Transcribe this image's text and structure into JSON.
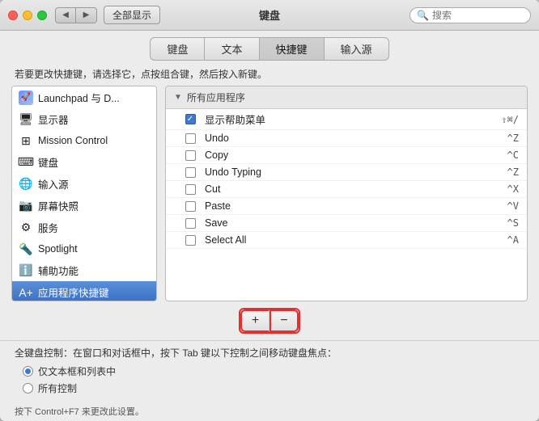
{
  "window": {
    "title": "键盘",
    "search_placeholder": "搜索"
  },
  "titlebar": {
    "show_all": "全部显示"
  },
  "tabs": [
    {
      "id": "keyboard",
      "label": "键盘"
    },
    {
      "id": "text",
      "label": "文本"
    },
    {
      "id": "shortcuts",
      "label": "快捷键",
      "active": true
    },
    {
      "id": "input",
      "label": "输入源"
    }
  ],
  "instruction": "若要更改快捷键，请选择它，点按组合键，然后按入新键。",
  "left_panel": {
    "items": [
      {
        "id": "launchpad",
        "label": "Launchpad 与 D...",
        "icon": "🚀"
      },
      {
        "id": "display",
        "label": "显示器",
        "icon": "🖥"
      },
      {
        "id": "mission",
        "label": "Mission Control",
        "icon": "⊞"
      },
      {
        "id": "keyboard",
        "label": "键盘",
        "icon": "⌨"
      },
      {
        "id": "inputsource",
        "label": "输入源",
        "icon": "🌐"
      },
      {
        "id": "screenshot",
        "label": "屏幕快照",
        "icon": "📷"
      },
      {
        "id": "service",
        "label": "服务",
        "icon": "⚙"
      },
      {
        "id": "spotlight",
        "label": "Spotlight",
        "icon": "🔍"
      },
      {
        "id": "accessibility",
        "label": "辅助功能",
        "icon": "ℹ"
      },
      {
        "id": "appshortcuts",
        "label": "应用程序快捷键",
        "icon": "A+",
        "selected": true
      }
    ]
  },
  "right_panel": {
    "header": "所有应用程序",
    "rows": [
      {
        "id": "show-help",
        "label": "显示帮助菜单",
        "checked": true,
        "shortcut": "⇧⌘/"
      },
      {
        "id": "undo",
        "label": "Undo",
        "checked": false,
        "shortcut": "^Z"
      },
      {
        "id": "copy",
        "label": "Copy",
        "checked": false,
        "shortcut": "^C"
      },
      {
        "id": "undo-typing",
        "label": "Undo Typing",
        "checked": false,
        "shortcut": "^Z"
      },
      {
        "id": "cut",
        "label": "Cut",
        "checked": false,
        "shortcut": "^X"
      },
      {
        "id": "paste",
        "label": "Paste",
        "checked": false,
        "shortcut": "^V"
      },
      {
        "id": "save",
        "label": "Save",
        "checked": false,
        "shortcut": "^S"
      },
      {
        "id": "select-all",
        "label": "Select All",
        "checked": false,
        "shortcut": "^A"
      }
    ]
  },
  "bottom_buttons": {
    "plus_label": "+",
    "minus_label": "−"
  },
  "bottom_section": {
    "title": "全键盘控制：在窗口和对话框中，按下 Tab 键以下控制之间移动键盘焦点：",
    "radios": [
      {
        "id": "text-lists",
        "label": "仅文本框和列表中",
        "selected": true
      },
      {
        "id": "all-controls",
        "label": "所有控制"
      }
    ],
    "footer": "按下 Control+F7 来更改此设置。"
  }
}
